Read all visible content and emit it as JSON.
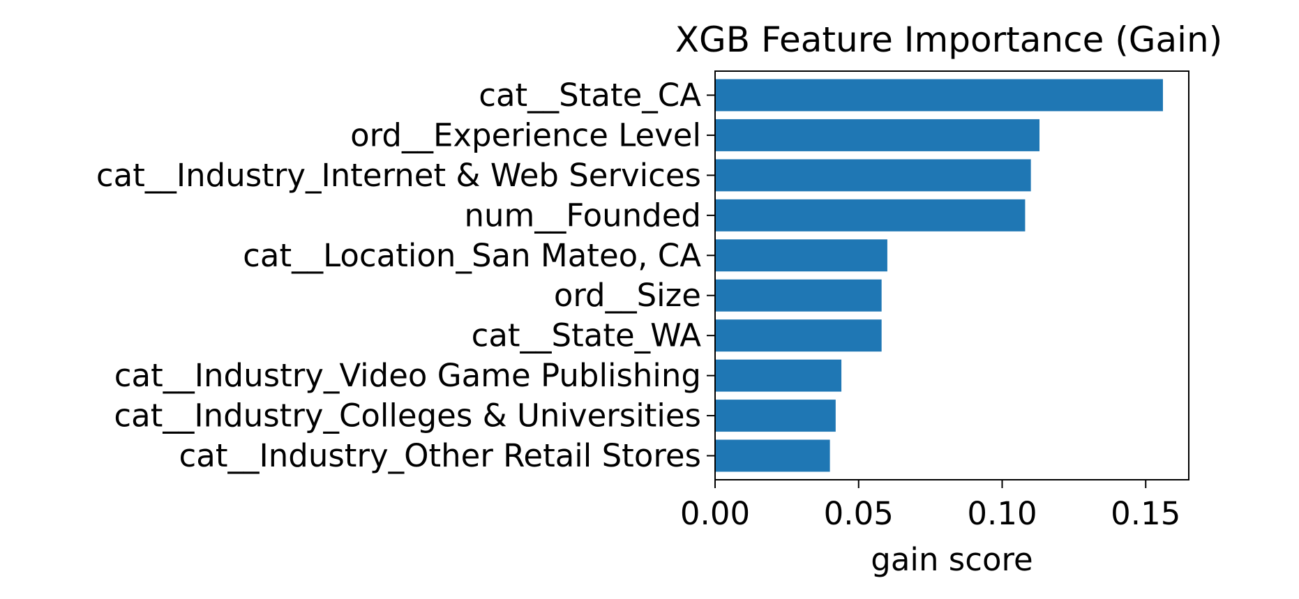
{
  "chart_data": {
    "type": "bar",
    "orientation": "horizontal",
    "title": "XGB Feature Importance (Gain)",
    "xlabel": "gain score",
    "ylabel": "",
    "xlim": [
      0,
      0.165
    ],
    "xticks": [
      0.0,
      0.05,
      0.1,
      0.15
    ],
    "xtick_labels": [
      "0.00",
      "0.05",
      "0.10",
      "0.15"
    ],
    "categories": [
      "cat__State_CA",
      "ord__Experience Level",
      "cat__Industry_Internet & Web Services",
      "num__Founded",
      "cat__Location_San Mateo, CA",
      "ord__Size",
      "cat__State_WA",
      "cat__Industry_Video Game Publishing",
      "cat__Industry_Colleges & Universities",
      "cat__Industry_Other Retail Stores"
    ],
    "values": [
      0.156,
      0.113,
      0.11,
      0.108,
      0.06,
      0.058,
      0.058,
      0.044,
      0.042,
      0.04
    ],
    "bar_color": "#1f77b4",
    "grid": false,
    "legend": "none"
  }
}
